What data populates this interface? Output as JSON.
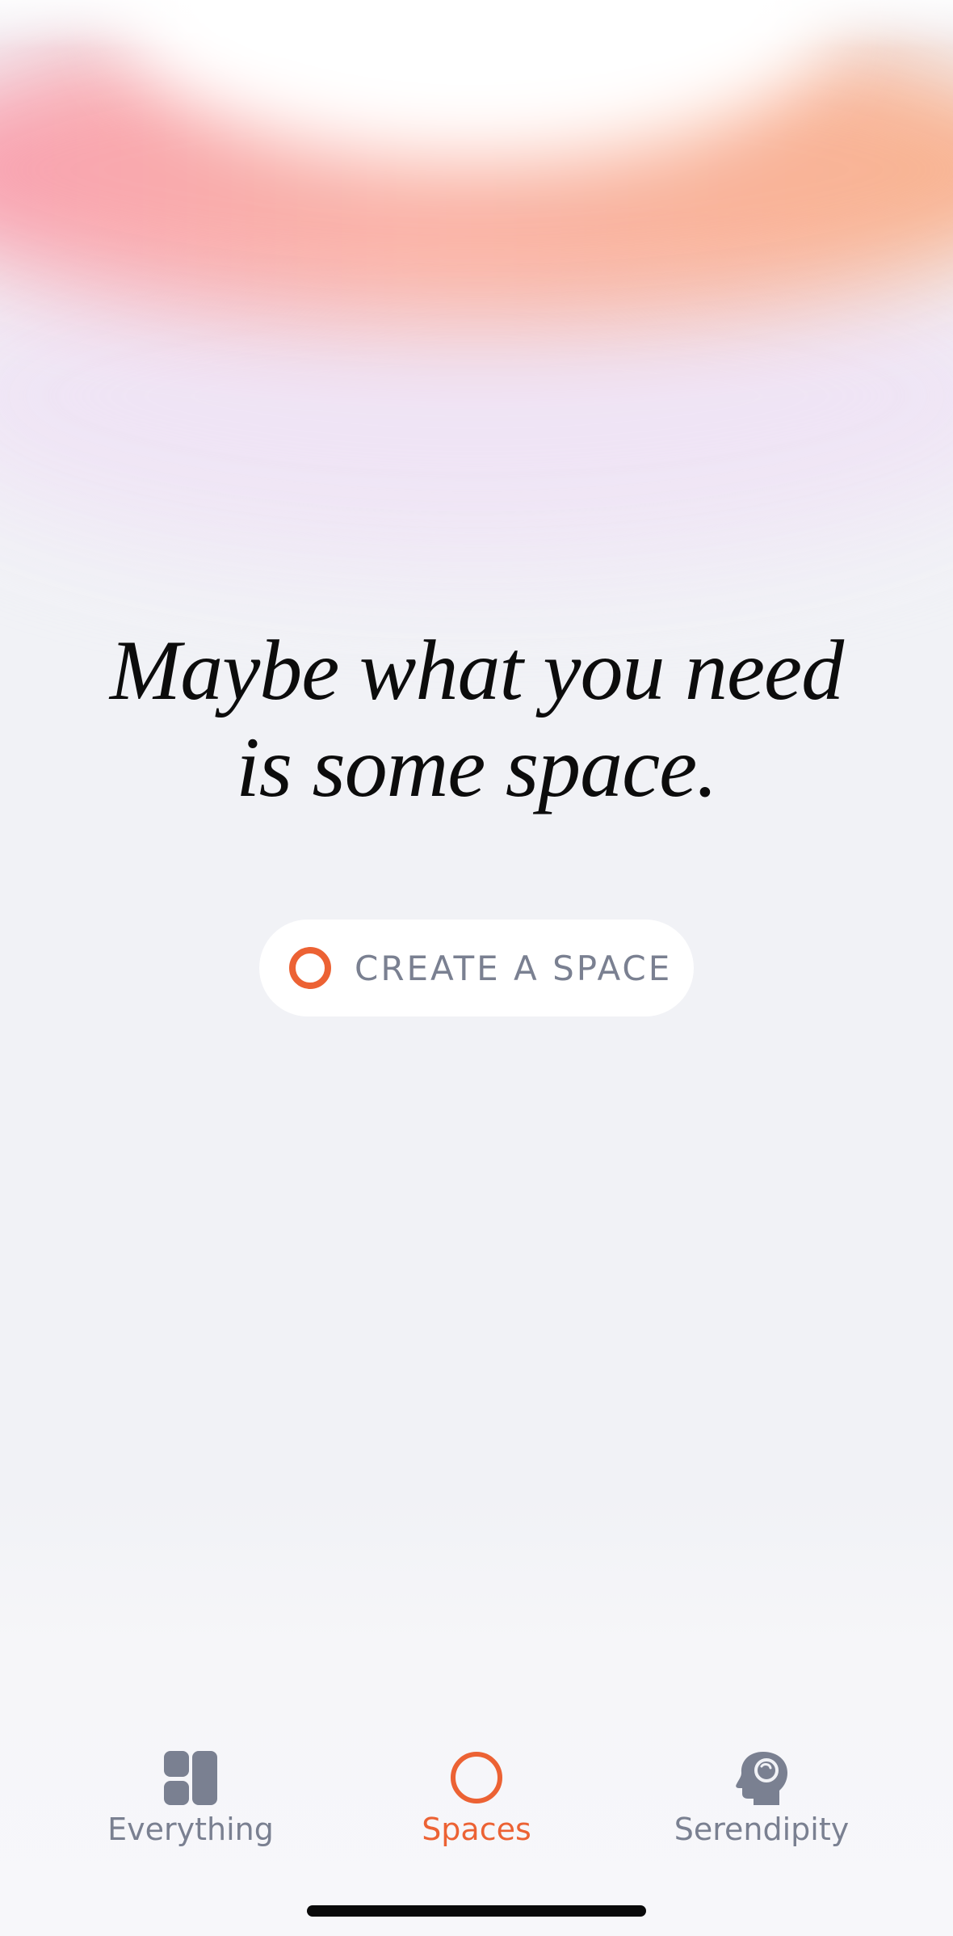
{
  "headline": {
    "line1": "Maybe what you need",
    "line2": "is some space."
  },
  "cta": {
    "label": "CREATE A SPACE",
    "icon": "ring-icon"
  },
  "tabbar": {
    "tabs": [
      {
        "label": "Everything",
        "icon": "grid-icon",
        "active": false
      },
      {
        "label": "Spaces",
        "icon": "ring-icon",
        "active": true
      },
      {
        "label": "Serendipity",
        "icon": "head-icon",
        "active": false
      }
    ]
  },
  "colors": {
    "accent": "#ec6234",
    "muted": "#7a8091",
    "background": "#f1f2f6",
    "text": "#0c0c0c"
  }
}
